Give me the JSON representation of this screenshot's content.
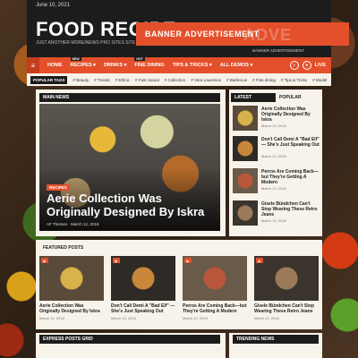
{
  "topbar": {
    "date": "June 10, 2021"
  },
  "header": {
    "logo": "FOOD RECIPE",
    "tagline": "JUST ANOTHER MOREINEWS PRO SITES SITE",
    "banner_text": "BANNER ADVERTISEMENT",
    "banner_ghost": "ADVE",
    "banner_sub": "BANNER ADVERTISEMENT"
  },
  "nav": {
    "items": [
      {
        "label": "HOME",
        "badge": ""
      },
      {
        "label": "RECIPES",
        "badge": "NEW"
      },
      {
        "label": "DRINKS",
        "badge": ""
      },
      {
        "label": "FINE DINING",
        "badge": "HOT"
      },
      {
        "label": "TIPS & TRICKS",
        "badge": ""
      },
      {
        "label": "ALL DEMOS",
        "badge": ""
      }
    ],
    "live": "LIVE"
  },
  "popular_tags": {
    "label": "POPULAR TAGS",
    "tags": [
      "Beauty",
      "Trends",
      "Ethnic",
      "Fast casual",
      "Collection",
      "Vera Lawrence",
      "Barbecue",
      "Fine dining",
      "Tips & Tricks",
      "Model"
    ]
  },
  "main_news": {
    "heading": "MAIN NEWS",
    "hero": {
      "category": "RECIPES",
      "title": "Aerie Collection Was Originally Designed By Iskra",
      "meta": "AF Themes  ·  March 12, 2018"
    }
  },
  "latest": {
    "tab_latest": "LATEST",
    "tab_popular": "POPULAR",
    "items": [
      {
        "title": "Aerie Collection Was Originally Designed By Iskra",
        "date": "March 12, 2018"
      },
      {
        "title": "Don't Call Demi A \"Bad Elf\" — She's Just Speaking Out",
        "date": "March 12, 2018"
      },
      {
        "title": "Perros Are Coming Back—but They're Getting A Modern",
        "date": "March 12, 2018"
      },
      {
        "title": "Gisele Bündchen Can't Stop Wearing These Retro Jeans",
        "date": "March 12, 2018"
      }
    ]
  },
  "featured": {
    "heading": "FEATURED POSTS",
    "items": [
      {
        "title": "Aerie Collection Was Originally Designed By Iskra",
        "date": "March 12, 2018"
      },
      {
        "title": "Don't Call Demi A \"Bad Elf\" — She's Just Speaking Out",
        "date": "March 12, 2018"
      },
      {
        "title": "Perros Are Coming Back—but They're Getting A Modern",
        "date": "March 12, 2018"
      },
      {
        "title": "Gisele Bündchen Can't Stop Wearing These Retro Jeans",
        "date": "March 12, 2018"
      }
    ]
  },
  "bottom": {
    "express": "EXPRESS POSTS GRID",
    "trending": "TRENDING NEWS"
  }
}
